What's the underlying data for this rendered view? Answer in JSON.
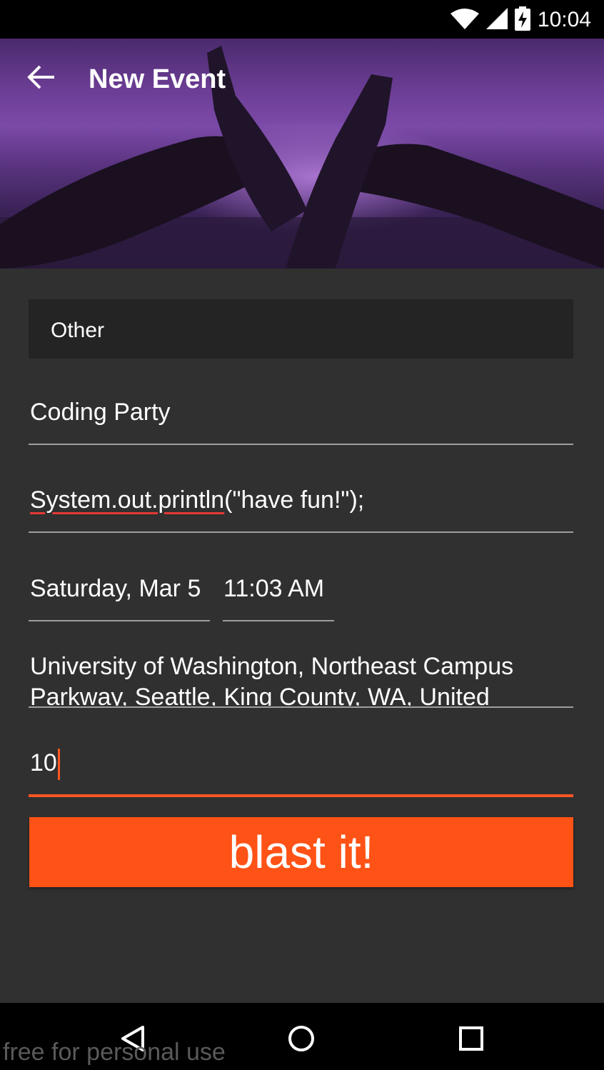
{
  "status_bar": {
    "time": "10:04",
    "icons": [
      "wifi-icon",
      "cell-signal-icon",
      "battery-charging-icon"
    ]
  },
  "toolbar": {
    "title": "New Event",
    "back_icon": "arrow-back-icon"
  },
  "colors": {
    "accent": "#ff5722",
    "background": "#303030",
    "spinner_bg": "#242424",
    "header_tint": "#6b3d94"
  },
  "form": {
    "category": "Other",
    "event_name": "Coding Party",
    "description_misspelled": "System.out.println",
    "description_rest": "(\"have fun!\");",
    "date": "Saturday, Mar 5",
    "time": "11:03 AM",
    "location_line1": "University of Washington, Northeast Campus",
    "location_line2": "Parkway, Seattle, King County, WA, United",
    "capacity": "10",
    "submit_label": "blast it!"
  },
  "nav": {
    "back_icon": "nav-back-icon",
    "home_icon": "nav-home-icon",
    "recents_icon": "nav-recents-icon"
  },
  "watermark": "free for personal use"
}
